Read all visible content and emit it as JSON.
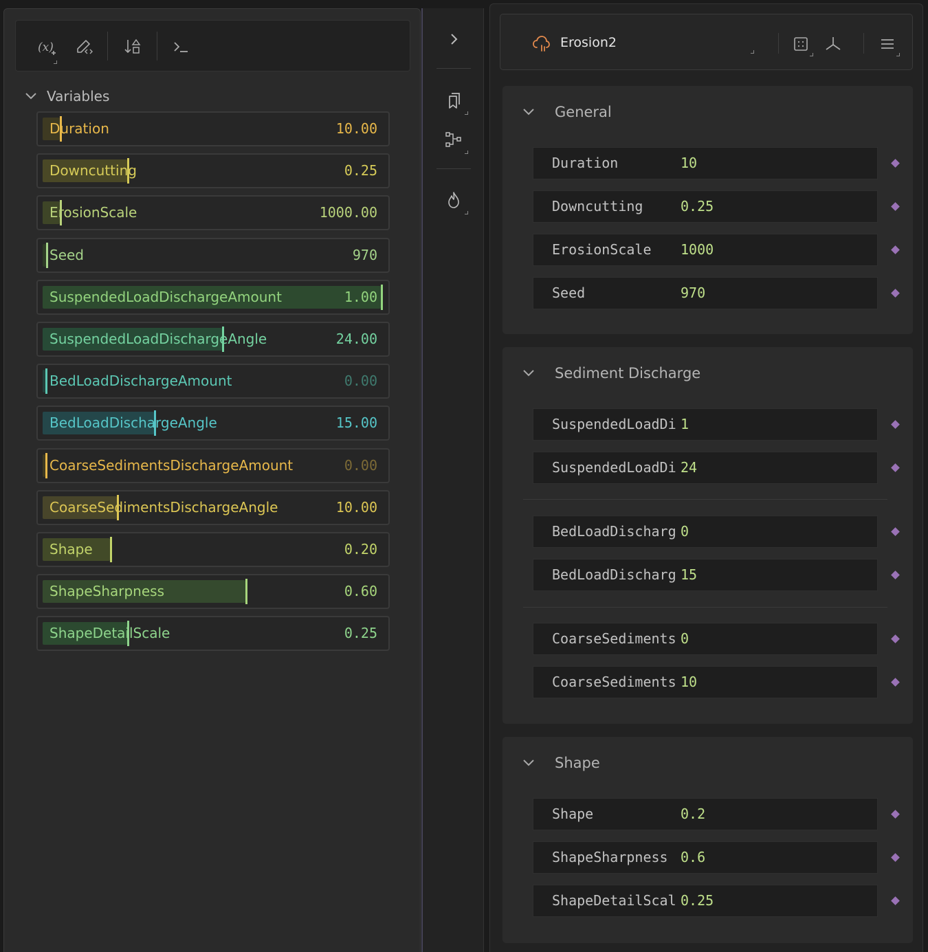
{
  "toolbar": {
    "buttons": [
      {
        "name": "add-variable-button",
        "icon": "variable-add-icon",
        "glyph": "(x)"
      },
      {
        "name": "edit-variable-button",
        "icon": "pencil-code-icon",
        "glyph": "✎"
      },
      {
        "name": "sort-variables-button",
        "icon": "sort-shapes-icon",
        "glyph": "⇣"
      },
      {
        "name": "console-button",
        "icon": "terminal-icon",
        "glyph": ">_"
      }
    ]
  },
  "variables": {
    "header": "Variables",
    "items": [
      {
        "name": "Duration",
        "value": "10.00",
        "fraction": 0.05,
        "color": "#e8b84a",
        "fill": "#3e3a22",
        "marker": "#e8b84a"
      },
      {
        "name": "Downcutting",
        "value": "0.25",
        "fraction": 0.25,
        "color": "#d6cb58",
        "fill": "#4a4826",
        "marker": "#d6cb58"
      },
      {
        "name": "ErosionScale",
        "value": "1000.00",
        "fraction": 0.05,
        "color": "#b9d37b",
        "fill": "#3e4527",
        "marker": "#b9d37b"
      },
      {
        "name": "Seed",
        "value": "970",
        "fraction": 0.01,
        "color": "#a5d38a",
        "fill": "#2e3a26",
        "marker": "#a5d38a"
      },
      {
        "name": "SuspendedLoadDischargeAmount",
        "value": "1.00",
        "fraction": 1.0,
        "color": "#93d47e",
        "fill": "#2d4a2f",
        "marker": "#93d47e"
      },
      {
        "name": "SuspendedLoadDischargeAngle",
        "value": "24.00",
        "fraction": 0.53,
        "color": "#74d2a0",
        "fill": "#274a36",
        "marker": "#74d2a0"
      },
      {
        "name": "BedLoadDischargeAmount",
        "value": "0.00",
        "fraction": 0.0,
        "color": "#5cc8b4",
        "fill": "#243f3a",
        "marker": "#5cc8b4",
        "value_color": "#3f7a6e"
      },
      {
        "name": "BedLoadDischargeAngle",
        "value": "15.00",
        "fraction": 0.33,
        "color": "#56c6c8",
        "fill": "#24474a",
        "marker": "#56c6c8"
      },
      {
        "name": "CoarseSedimentsDischargeAmount",
        "value": "0.00",
        "fraction": 0.0,
        "color": "#e8b84a",
        "fill": "#3e3a22",
        "marker": "#e8b84a",
        "value_color": "#7c6a36"
      },
      {
        "name": "CoarseSedimentsDischargeAngle",
        "value": "10.00",
        "fraction": 0.22,
        "color": "#dcc654",
        "fill": "#48452a",
        "marker": "#dcc654"
      },
      {
        "name": "Shape",
        "value": "0.20",
        "fraction": 0.2,
        "color": "#c2d46a",
        "fill": "#424a28",
        "marker": "#c2d46a"
      },
      {
        "name": "ShapeSharpness",
        "value": "0.60",
        "fraction": 0.6,
        "color": "#a7d67c",
        "fill": "#354a2e",
        "marker": "#a7d67c"
      },
      {
        "name": "ShapeDetailScale",
        "value": "0.25",
        "fraction": 0.25,
        "color": "#8ed48c",
        "fill": "#2c4a30",
        "marker": "#8ed48c"
      }
    ]
  },
  "side_strip": {
    "buttons": [
      {
        "name": "collapse-panel-button",
        "icon": "chevron-right-icon"
      },
      {
        "name": "bookmarks-button",
        "icon": "bookmark-copy-icon"
      },
      {
        "name": "graph-button",
        "icon": "node-graph-icon"
      },
      {
        "name": "burn-button",
        "icon": "flame-icon"
      }
    ]
  },
  "node": {
    "title": "Erosion2",
    "icon": "cloud-rain-icon",
    "icon_color": "#e38a4d",
    "buttons": [
      {
        "name": "grid-button",
        "icon": "dotted-square-icon"
      },
      {
        "name": "axes-button",
        "icon": "axes-3d-icon"
      },
      {
        "name": "menu-button",
        "icon": "hamburger-icon"
      }
    ]
  },
  "sections": [
    {
      "title": "General",
      "props": [
        {
          "label": "Duration",
          "value": "10"
        },
        {
          "label": "Downcutting",
          "value": "0.25"
        },
        {
          "label": "ErosionScale",
          "value": "1000"
        },
        {
          "label": "Seed",
          "value": "970"
        }
      ]
    },
    {
      "title": "Sediment Discharge",
      "props": [
        {
          "label": "SuspendedLoadDis",
          "value": "1"
        },
        {
          "label": "SuspendedLoadDis",
          "value": "24"
        },
        {
          "label": "BedLoadDischarge",
          "value": "0"
        },
        {
          "label": "BedLoadDischarge",
          "value": "15"
        },
        {
          "label": "CoarseSedimentsD",
          "value": "0"
        },
        {
          "label": "CoarseSedimentsD",
          "value": "10"
        }
      ]
    },
    {
      "title": "Shape",
      "props": [
        {
          "label": "Shape",
          "value": "0.2"
        },
        {
          "label": "ShapeSharpness",
          "value": "0.6"
        },
        {
          "label": "ShapeDetailScale",
          "value": "0.25"
        }
      ]
    }
  ]
}
